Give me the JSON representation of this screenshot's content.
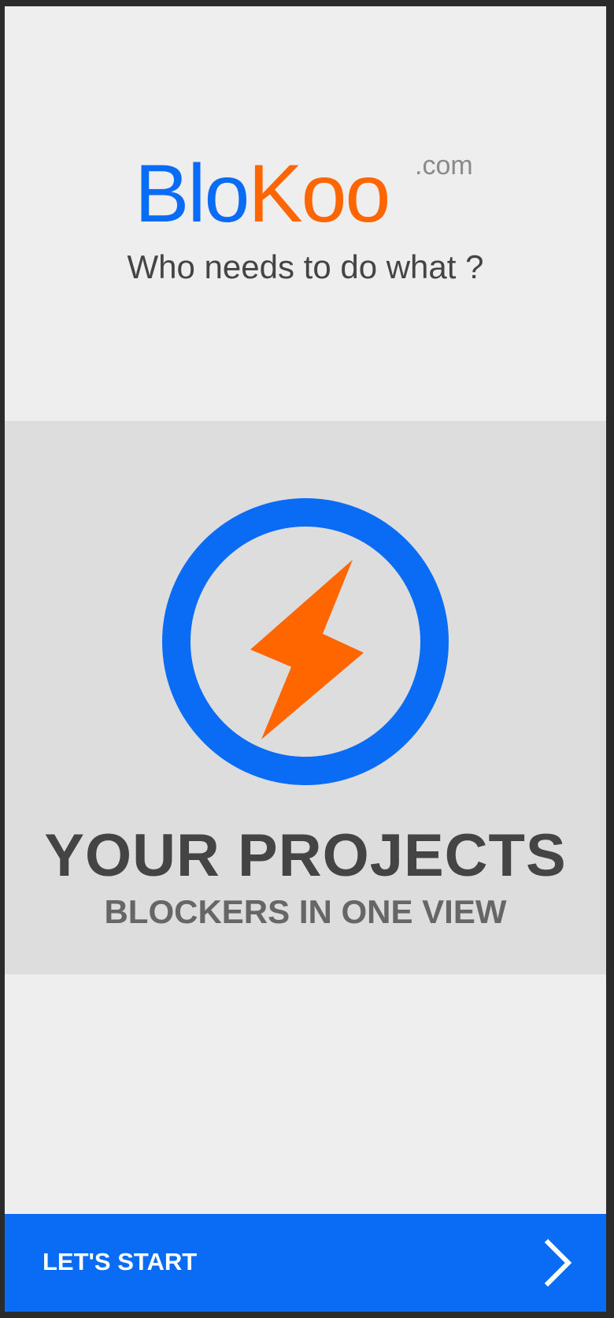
{
  "brand": {
    "name_part1": "Blo",
    "name_part2": "Koo",
    "tld": ".com",
    "tagline": "Who needs to do what ?"
  },
  "hero": {
    "icon": "lightning-bolt-in-circle-icon",
    "title": "YOUR PROJECTS",
    "subtitle": "BLOCKERS IN ONE VIEW"
  },
  "cta": {
    "label": "LET'S START",
    "icon": "chevron-right-icon"
  },
  "colors": {
    "brand_blue": "#0a6cf5",
    "brand_orange": "#ff6600",
    "background": "#eeeeee",
    "hero_background": "#dddddd",
    "text_dark": "#444444"
  }
}
